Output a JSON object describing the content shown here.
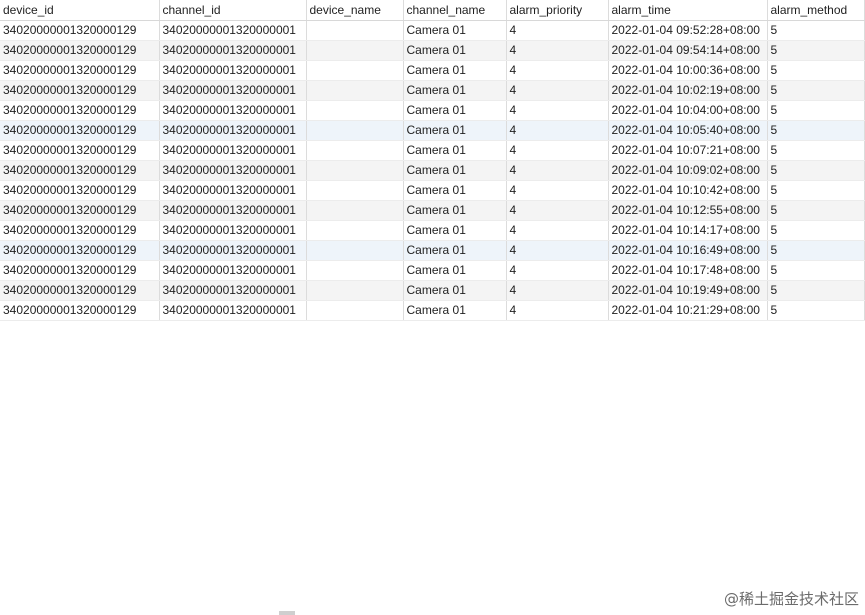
{
  "table": {
    "columns": [
      "device_id",
      "channel_id",
      "device_name",
      "channel_name",
      "alarm_priority",
      "alarm_time",
      "alarm_method"
    ],
    "rows": [
      [
        "34020000001320000129",
        "34020000001320000001",
        "",
        "Camera 01",
        "4",
        "2022-01-04 09:52:28+08:00",
        "5"
      ],
      [
        "34020000001320000129",
        "34020000001320000001",
        "",
        "Camera 01",
        "4",
        "2022-01-04 09:54:14+08:00",
        "5"
      ],
      [
        "34020000001320000129",
        "34020000001320000001",
        "",
        "Camera 01",
        "4",
        "2022-01-04 10:00:36+08:00",
        "5"
      ],
      [
        "34020000001320000129",
        "34020000001320000001",
        "",
        "Camera 01",
        "4",
        "2022-01-04 10:02:19+08:00",
        "5"
      ],
      [
        "34020000001320000129",
        "34020000001320000001",
        "",
        "Camera 01",
        "4",
        "2022-01-04 10:04:00+08:00",
        "5"
      ],
      [
        "34020000001320000129",
        "34020000001320000001",
        "",
        "Camera 01",
        "4",
        "2022-01-04 10:05:40+08:00",
        "5"
      ],
      [
        "34020000001320000129",
        "34020000001320000001",
        "",
        "Camera 01",
        "4",
        "2022-01-04 10:07:21+08:00",
        "5"
      ],
      [
        "34020000001320000129",
        "34020000001320000001",
        "",
        "Camera 01",
        "4",
        "2022-01-04 10:09:02+08:00",
        "5"
      ],
      [
        "34020000001320000129",
        "34020000001320000001",
        "",
        "Camera 01",
        "4",
        "2022-01-04 10:10:42+08:00",
        "5"
      ],
      [
        "34020000001320000129",
        "34020000001320000001",
        "",
        "Camera 01",
        "4",
        "2022-01-04 10:12:55+08:00",
        "5"
      ],
      [
        "34020000001320000129",
        "34020000001320000001",
        "",
        "Camera 01",
        "4",
        "2022-01-04 10:14:17+08:00",
        "5"
      ],
      [
        "34020000001320000129",
        "34020000001320000001",
        "",
        "Camera 01",
        "4",
        "2022-01-04 10:16:49+08:00",
        "5"
      ],
      [
        "34020000001320000129",
        "34020000001320000001",
        "",
        "Camera 01",
        "4",
        "2022-01-04 10:17:48+08:00",
        "5"
      ],
      [
        "34020000001320000129",
        "34020000001320000001",
        "",
        "Camera 01",
        "4",
        "2022-01-04 10:19:49+08:00",
        "5"
      ],
      [
        "34020000001320000129",
        "34020000001320000001",
        "",
        "Camera 01",
        "4",
        "2022-01-04 10:21:29+08:00",
        "5"
      ]
    ],
    "highlighted_rows": [
      5,
      11
    ]
  },
  "watermark": "@稀土掘金技术社区"
}
